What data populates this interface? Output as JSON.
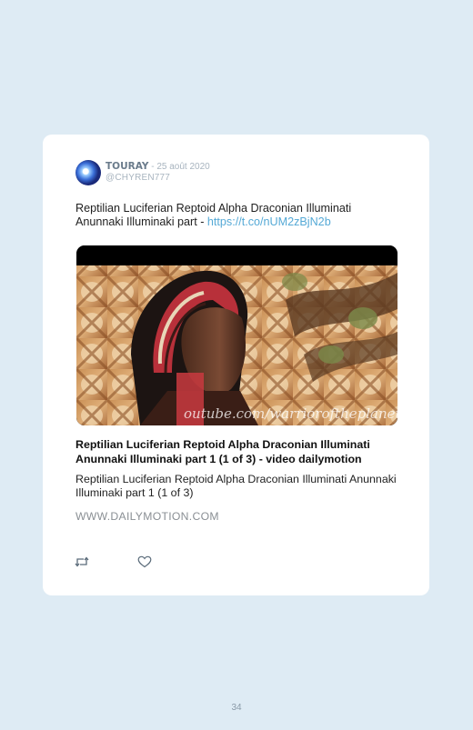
{
  "tweet": {
    "author_name": "TOURAY",
    "date": " - 25 août 2020",
    "handle": "@CHYREN777",
    "text": "Reptilian Luciferian Reptoid Alpha Draconian Illuminati Anunnaki Illuminaki part - ",
    "link": "https://t.co/nUM2zBjN2b"
  },
  "media": {
    "watermark": "outube.com/warrioroftheplanet"
  },
  "link_card": {
    "title": "Reptilian Luciferian Reptoid Alpha Draconian Illuminati Anunnaki Illuminaki part 1 (1 of 3) - video dailymotion",
    "description": "Reptilian Luciferian Reptoid Alpha Draconian Illuminati Anunnaki Illuminaki part 1 (1 of 3)",
    "domain": "WWW.DAILYMOTION.COM"
  },
  "actions": {
    "retweet_icon": "retweet-icon",
    "like_icon": "heart-icon"
  },
  "page": {
    "number": "34"
  },
  "colors": {
    "background": "#deebf4",
    "link": "#55a9d6",
    "muted": "#a8b4bf"
  }
}
